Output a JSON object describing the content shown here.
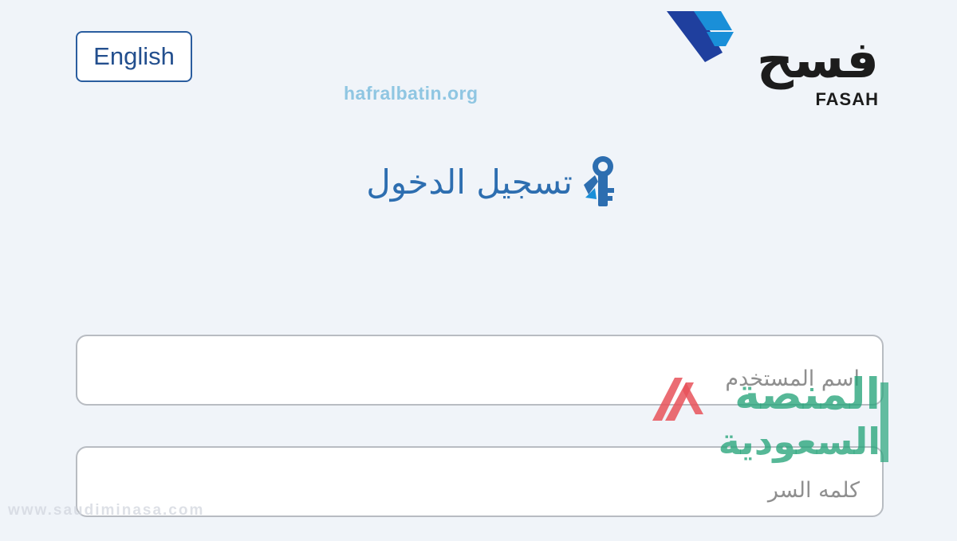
{
  "header": {
    "language_toggle": "English",
    "logo_arabic": "فسح",
    "logo_latin": "FASAH"
  },
  "watermarks": {
    "top": "hafralbatin.org",
    "brand_line1": "المنصة",
    "brand_line2": "السعودية",
    "bottom": "www.saudiminasa.com"
  },
  "login": {
    "title": "تسجيل الدخول",
    "username_placeholder": "اسم المستخدم",
    "password_placeholder": "كلمه السر"
  },
  "colors": {
    "accent": "#2d6eb0",
    "logo_blue_dark": "#1f3f9e",
    "logo_blue_light": "#1a8fd8",
    "watermark_green": "#26a47a",
    "watermark_red": "#e8525a"
  },
  "icons": {
    "login": "key-icon"
  }
}
